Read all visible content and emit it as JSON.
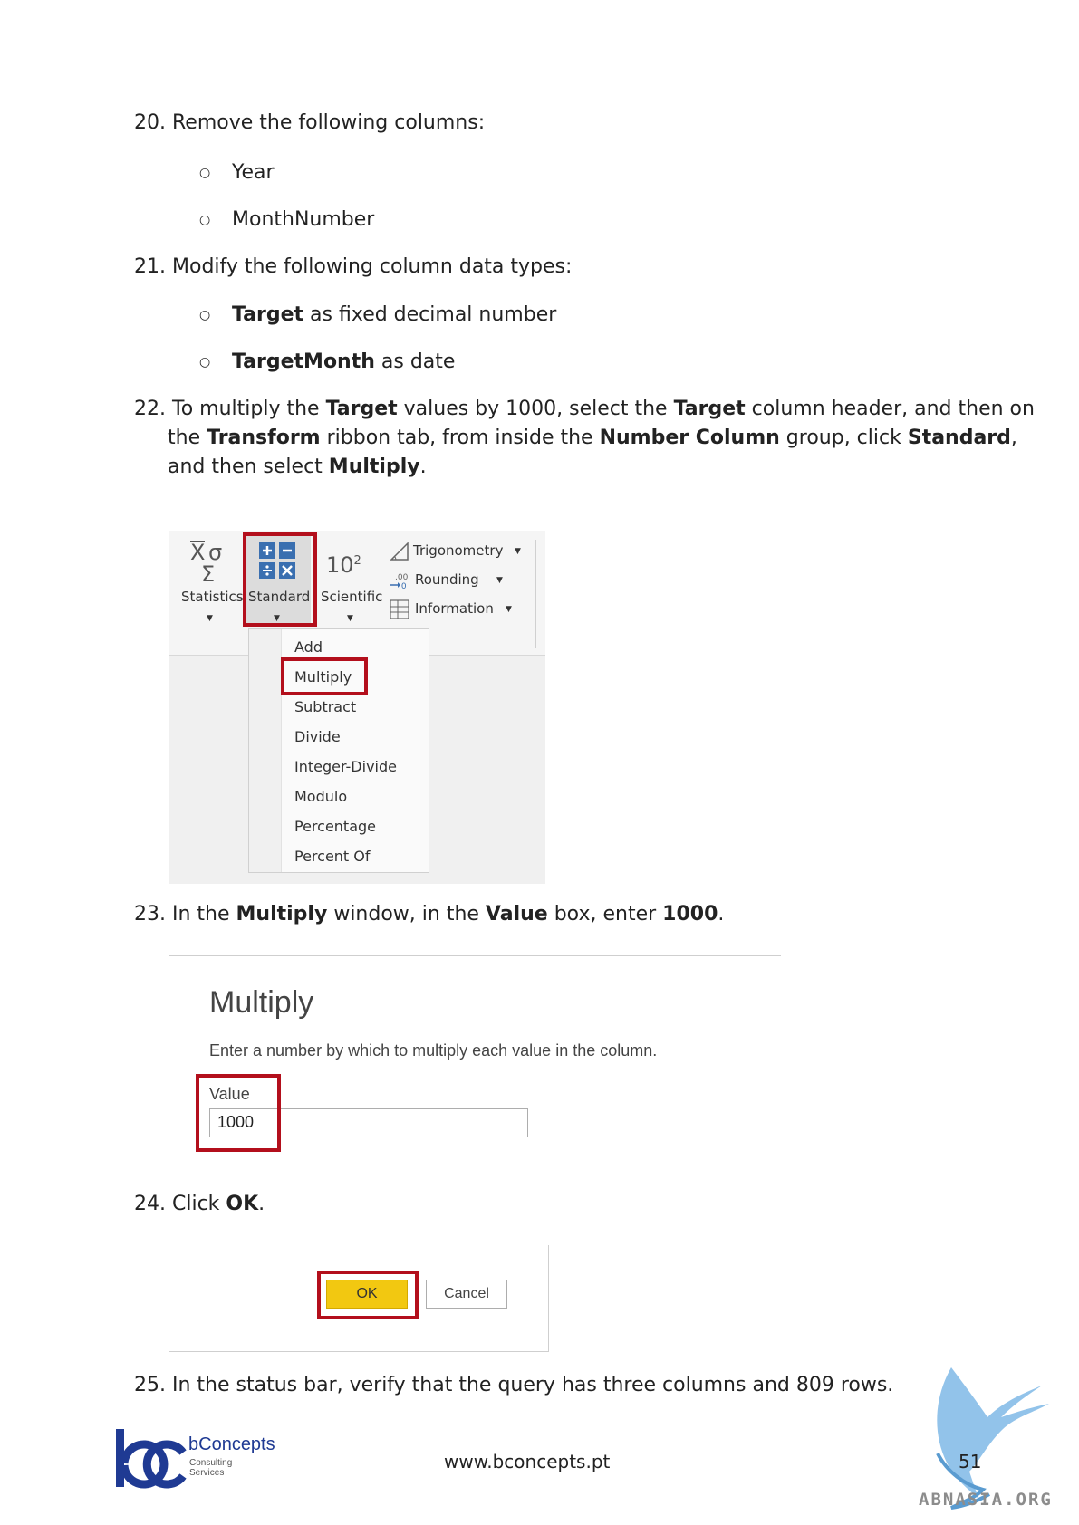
{
  "steps": {
    "s20": {
      "num": "20.",
      "text": "Remove the following columns:"
    },
    "s20_items": [
      "Year",
      "MonthNumber"
    ],
    "s21": {
      "num": "21.",
      "text": "Modify the following column data types:"
    },
    "s21_items": [
      {
        "bold": "Target",
        "rest": " as fixed decimal number"
      },
      {
        "bold": "TargetMonth",
        "rest": " as date"
      }
    ],
    "s22": {
      "num": "22.",
      "p1": "To multiply the ",
      "b1": "Target",
      "p2": " values by 1000, select the ",
      "b2": "Target",
      "p3": " column header, and then on",
      "p4": "the ",
      "b3": "Transform",
      "p5": " ribbon tab, from inside the ",
      "b4": "Number Column",
      "p6": " group, click ",
      "b5": "Standard",
      "p7": ",",
      "p8": "and then select ",
      "b6": "Multiply",
      "p9": "."
    },
    "s23": {
      "num": "23.",
      "p1": "In the ",
      "b1": "Multiply",
      "p2": " window, in the ",
      "b2": "Value",
      "p3": " box, enter ",
      "b3": "1000",
      "p4": "."
    },
    "s24": {
      "num": "24.",
      "p1": "Click ",
      "b1": "OK",
      "p2": "."
    },
    "s25": {
      "num": "25.",
      "text": "In the status bar, verify that the query has three columns and 809 rows."
    }
  },
  "ribbon": {
    "statistics_label": "Statistics",
    "standard_label": "Standard",
    "scientific_label": "Scientific",
    "scientific_glyph": "10",
    "scientific_sup": "2",
    "trigonometry_label": "Trigonometry",
    "rounding_label": "Rounding",
    "information_label": "Information",
    "menu_items": [
      "Add",
      "Multiply",
      "Subtract",
      "Divide",
      "Integer-Divide",
      "Modulo",
      "Percentage",
      "Percent Of"
    ]
  },
  "dialog": {
    "title": "Multiply",
    "description": "Enter a number by which to multiply each value in the column.",
    "value_label": "Value",
    "value": "1000"
  },
  "buttons": {
    "ok": "OK",
    "cancel": "Cancel"
  },
  "footer": {
    "logo_text": "bConcepts",
    "logo_sub1": "Consulting",
    "logo_sub2": "Services",
    "url": "www.bconcepts.pt",
    "page": "51",
    "watermark": "ABNASIA.ORG"
  },
  "colors": {
    "highlight": "#b30f1c",
    "ok_button": "#f2c811",
    "logo_blue": "#1f3a93"
  }
}
